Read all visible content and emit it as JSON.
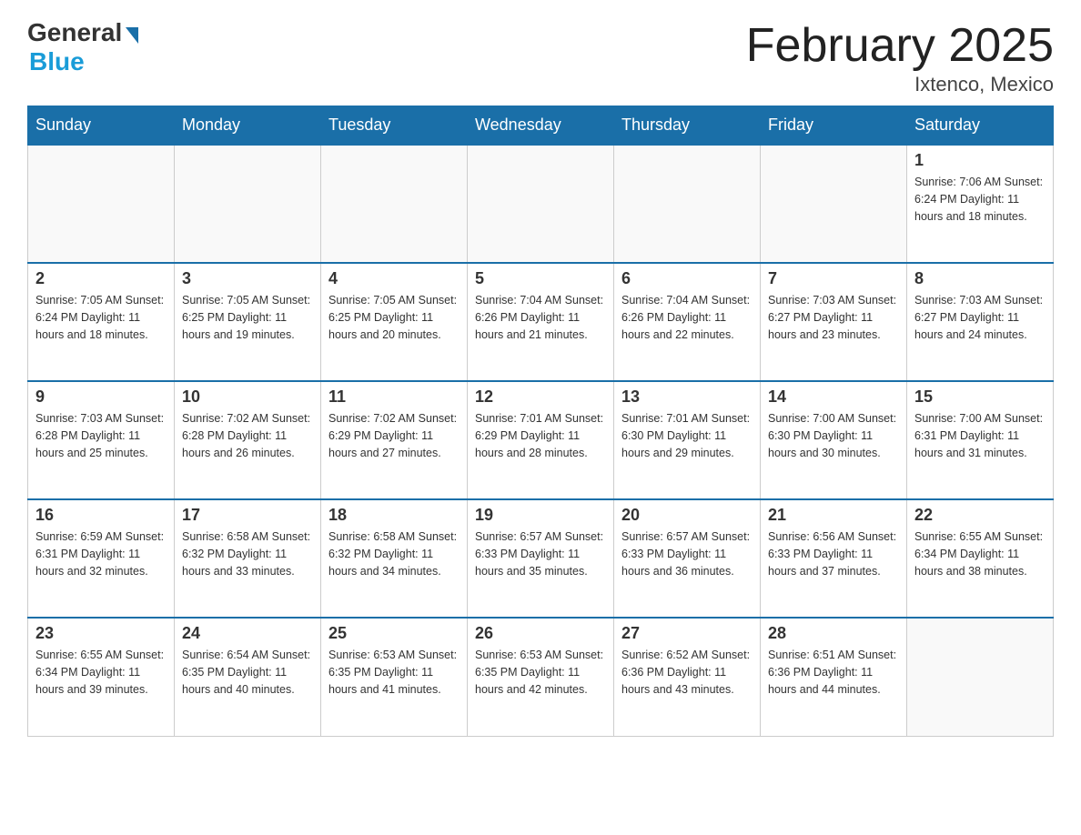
{
  "header": {
    "logo_general": "General",
    "logo_blue": "Blue",
    "title": "February 2025",
    "subtitle": "Ixtenco, Mexico"
  },
  "days_of_week": [
    "Sunday",
    "Monday",
    "Tuesday",
    "Wednesday",
    "Thursday",
    "Friday",
    "Saturday"
  ],
  "weeks": [
    [
      {
        "day": "",
        "info": ""
      },
      {
        "day": "",
        "info": ""
      },
      {
        "day": "",
        "info": ""
      },
      {
        "day": "",
        "info": ""
      },
      {
        "day": "",
        "info": ""
      },
      {
        "day": "",
        "info": ""
      },
      {
        "day": "1",
        "info": "Sunrise: 7:06 AM\nSunset: 6:24 PM\nDaylight: 11 hours\nand 18 minutes."
      }
    ],
    [
      {
        "day": "2",
        "info": "Sunrise: 7:05 AM\nSunset: 6:24 PM\nDaylight: 11 hours\nand 18 minutes."
      },
      {
        "day": "3",
        "info": "Sunrise: 7:05 AM\nSunset: 6:25 PM\nDaylight: 11 hours\nand 19 minutes."
      },
      {
        "day": "4",
        "info": "Sunrise: 7:05 AM\nSunset: 6:25 PM\nDaylight: 11 hours\nand 20 minutes."
      },
      {
        "day": "5",
        "info": "Sunrise: 7:04 AM\nSunset: 6:26 PM\nDaylight: 11 hours\nand 21 minutes."
      },
      {
        "day": "6",
        "info": "Sunrise: 7:04 AM\nSunset: 6:26 PM\nDaylight: 11 hours\nand 22 minutes."
      },
      {
        "day": "7",
        "info": "Sunrise: 7:03 AM\nSunset: 6:27 PM\nDaylight: 11 hours\nand 23 minutes."
      },
      {
        "day": "8",
        "info": "Sunrise: 7:03 AM\nSunset: 6:27 PM\nDaylight: 11 hours\nand 24 minutes."
      }
    ],
    [
      {
        "day": "9",
        "info": "Sunrise: 7:03 AM\nSunset: 6:28 PM\nDaylight: 11 hours\nand 25 minutes."
      },
      {
        "day": "10",
        "info": "Sunrise: 7:02 AM\nSunset: 6:28 PM\nDaylight: 11 hours\nand 26 minutes."
      },
      {
        "day": "11",
        "info": "Sunrise: 7:02 AM\nSunset: 6:29 PM\nDaylight: 11 hours\nand 27 minutes."
      },
      {
        "day": "12",
        "info": "Sunrise: 7:01 AM\nSunset: 6:29 PM\nDaylight: 11 hours\nand 28 minutes."
      },
      {
        "day": "13",
        "info": "Sunrise: 7:01 AM\nSunset: 6:30 PM\nDaylight: 11 hours\nand 29 minutes."
      },
      {
        "day": "14",
        "info": "Sunrise: 7:00 AM\nSunset: 6:30 PM\nDaylight: 11 hours\nand 30 minutes."
      },
      {
        "day": "15",
        "info": "Sunrise: 7:00 AM\nSunset: 6:31 PM\nDaylight: 11 hours\nand 31 minutes."
      }
    ],
    [
      {
        "day": "16",
        "info": "Sunrise: 6:59 AM\nSunset: 6:31 PM\nDaylight: 11 hours\nand 32 minutes."
      },
      {
        "day": "17",
        "info": "Sunrise: 6:58 AM\nSunset: 6:32 PM\nDaylight: 11 hours\nand 33 minutes."
      },
      {
        "day": "18",
        "info": "Sunrise: 6:58 AM\nSunset: 6:32 PM\nDaylight: 11 hours\nand 34 minutes."
      },
      {
        "day": "19",
        "info": "Sunrise: 6:57 AM\nSunset: 6:33 PM\nDaylight: 11 hours\nand 35 minutes."
      },
      {
        "day": "20",
        "info": "Sunrise: 6:57 AM\nSunset: 6:33 PM\nDaylight: 11 hours\nand 36 minutes."
      },
      {
        "day": "21",
        "info": "Sunrise: 6:56 AM\nSunset: 6:33 PM\nDaylight: 11 hours\nand 37 minutes."
      },
      {
        "day": "22",
        "info": "Sunrise: 6:55 AM\nSunset: 6:34 PM\nDaylight: 11 hours\nand 38 minutes."
      }
    ],
    [
      {
        "day": "23",
        "info": "Sunrise: 6:55 AM\nSunset: 6:34 PM\nDaylight: 11 hours\nand 39 minutes."
      },
      {
        "day": "24",
        "info": "Sunrise: 6:54 AM\nSunset: 6:35 PM\nDaylight: 11 hours\nand 40 minutes."
      },
      {
        "day": "25",
        "info": "Sunrise: 6:53 AM\nSunset: 6:35 PM\nDaylight: 11 hours\nand 41 minutes."
      },
      {
        "day": "26",
        "info": "Sunrise: 6:53 AM\nSunset: 6:35 PM\nDaylight: 11 hours\nand 42 minutes."
      },
      {
        "day": "27",
        "info": "Sunrise: 6:52 AM\nSunset: 6:36 PM\nDaylight: 11 hours\nand 43 minutes."
      },
      {
        "day": "28",
        "info": "Sunrise: 6:51 AM\nSunset: 6:36 PM\nDaylight: 11 hours\nand 44 minutes."
      },
      {
        "day": "",
        "info": ""
      }
    ]
  ]
}
